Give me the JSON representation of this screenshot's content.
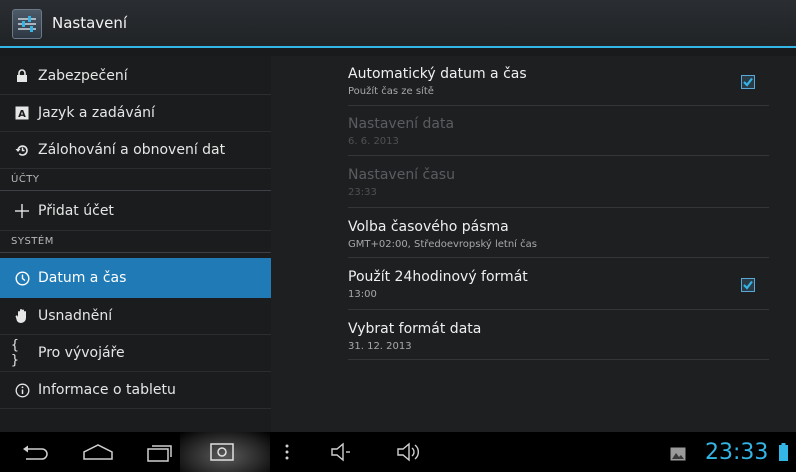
{
  "app": {
    "title": "Nastavení",
    "icon": "settings-sliders-icon"
  },
  "sidebar": {
    "items": [
      {
        "label": "Zabezpečení",
        "icon": "lock-icon"
      },
      {
        "label": "Jazyk a zadávání",
        "icon": "keyboard-a-icon"
      },
      {
        "label": "Zálohování a obnovení dat",
        "icon": "restore-icon"
      },
      {
        "label": "Přidat účet",
        "icon": "plus-icon"
      },
      {
        "label": "Datum a čas",
        "icon": "clock-icon",
        "selected": true
      },
      {
        "label": "Usnadnění",
        "icon": "hand-icon"
      },
      {
        "label": "Pro vývojáře",
        "icon": "braces-icon"
      },
      {
        "label": "Informace o tabletu",
        "icon": "info-icon"
      }
    ],
    "headers": {
      "accounts": "ÚČTY",
      "system": "SYSTÉM"
    }
  },
  "prefs": [
    {
      "title": "Automatický datum a čas",
      "summary": "Použít čas ze sítě",
      "checked": true,
      "enabled": true
    },
    {
      "title": "Nastavení data",
      "summary": "6. 6. 2013",
      "enabled": false
    },
    {
      "title": "Nastavení času",
      "summary": "23:33",
      "enabled": false
    },
    {
      "title": "Volba časového pásma",
      "summary": "GMT+02:00, Středoevropský letní čas",
      "enabled": true
    },
    {
      "title": "Použít 24hodinový formát",
      "summary": "13:00",
      "checked": true,
      "enabled": true
    },
    {
      "title": "Vybrat formát data",
      "summary": "31. 12. 2013",
      "enabled": true
    }
  ],
  "statusbar": {
    "time": "23:33",
    "icons": [
      "back-icon",
      "home-icon",
      "recent-apps-icon",
      "screenshot-icon",
      "menu-dots-icon",
      "volume-down-icon",
      "volume-up-icon",
      "image-notification-icon",
      "battery-icon"
    ]
  },
  "colors": {
    "accent": "#33b5e5",
    "selected": "#1f7ab5"
  }
}
